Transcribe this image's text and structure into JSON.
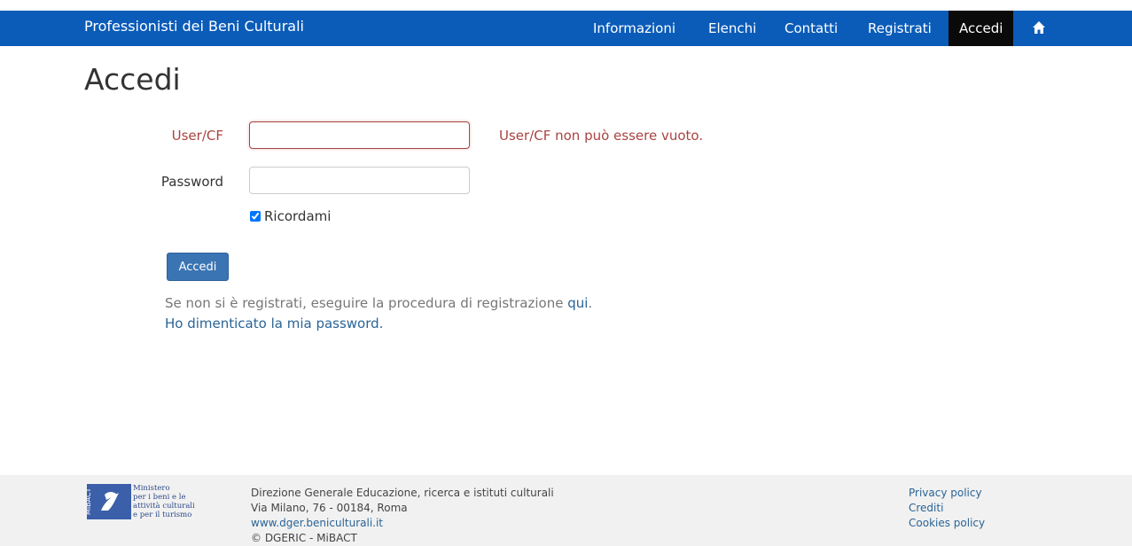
{
  "navbar": {
    "brand": "Professionisti dei Beni Culturali",
    "links": [
      "Informazioni",
      "Elenchi",
      "Contatti",
      "Registrati",
      "Accedi"
    ],
    "active": "Accedi",
    "home_icon": "home-icon",
    "background": "#0b5cb9"
  },
  "page": {
    "title": "Accedi"
  },
  "form": {
    "user_label": "User/CF",
    "user_value": "",
    "user_error": "User/CF non può essere vuoto.",
    "password_label": "Password",
    "password_value": "",
    "remember_label": "Ricordami",
    "remember_checked": true,
    "submit_label": "Accedi",
    "error_color": "#a94442"
  },
  "notes": {
    "register_text": "Se non si è registrati, eseguire la procedura di registrazione ",
    "register_link": "qui",
    "register_suffix": ".",
    "forgot_link": "Ho dimenticato la mia password."
  },
  "footer": {
    "logo_lines": [
      "Ministero",
      "per i beni e le",
      "attività culturali",
      "e per il turismo"
    ],
    "logo_mark": "MiBACT",
    "org": "Direzione Generale Educazione, ricerca e istituti culturali",
    "address": "Via Milano, 76 - 00184, Roma",
    "website": "www.dger.beniculturali.it",
    "copyright": "© DGERIC - MiBACT",
    "links": [
      "Privacy policy",
      "Crediti",
      "Cookies policy"
    ]
  }
}
